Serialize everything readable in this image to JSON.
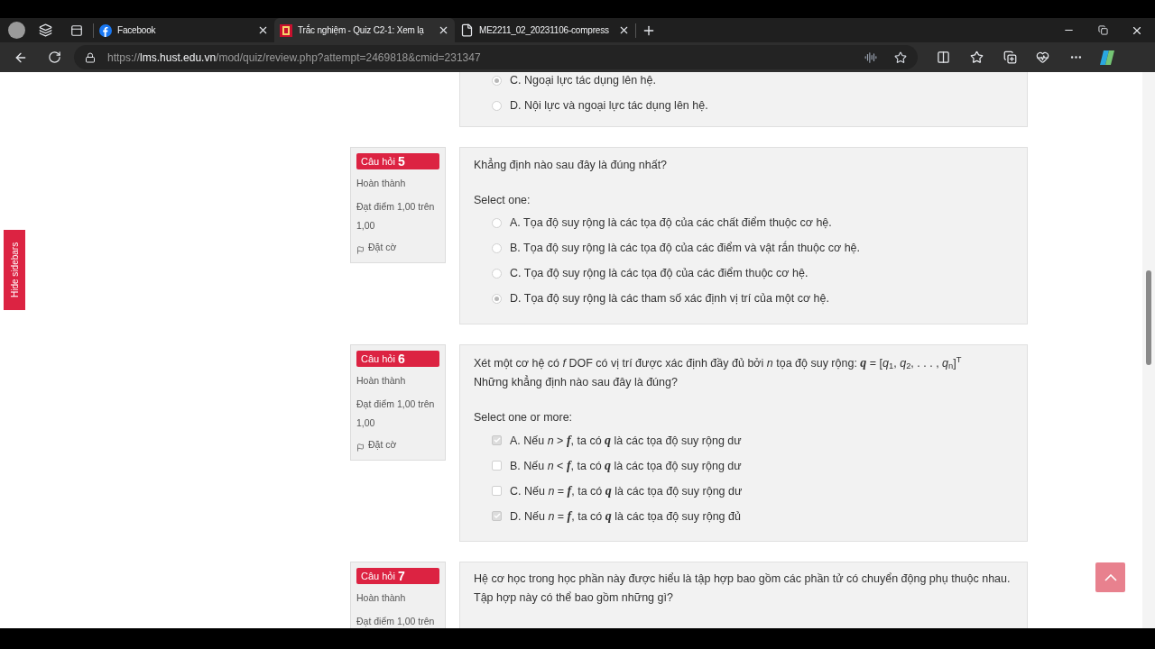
{
  "browser": {
    "tabs": [
      {
        "title": "Facebook",
        "selected": false
      },
      {
        "title": "Trắc nghiệm - Quiz C2-1: Xem lạ",
        "selected": true
      },
      {
        "title": "ME2211_02_20231106-compress",
        "selected": false
      }
    ],
    "address": {
      "scheme": "https://",
      "host": "lms.hust.edu.vn",
      "path": "/mod/quiz/review.php?attempt=2469818&cmid=231347"
    }
  },
  "sidebar_toggle": "Hide sidebars",
  "questions": [
    {
      "options": [
        {
          "kind": "radio",
          "label": "C. Ngoại lực tác dụng lên hệ.",
          "selected": true
        },
        {
          "kind": "radio",
          "label": "D. Nội lực và ngoại lực tác dụng lên hệ.",
          "selected": false
        }
      ]
    },
    {
      "info": {
        "label": "Câu hỏi",
        "number": "5",
        "status": "Hoàn thành",
        "mark": "Đạt điểm 1,00 trên 1,00",
        "flag": "Đặt cờ"
      },
      "prompt": [
        "Khẳng định nào sau đây là đúng nhất?"
      ],
      "instruction": "Select one:",
      "options": [
        {
          "kind": "radio",
          "label": "A. Tọa độ suy rộng là các tọa độ của các chất điểm thuộc cơ hệ.",
          "selected": false
        },
        {
          "kind": "radio",
          "label": "B. Tọa độ suy rộng là các tọa độ của các điểm và vật rắn thuộc cơ hệ.",
          "selected": false
        },
        {
          "kind": "radio",
          "label": "C. Tọa độ suy rộng là các tọa độ của các điểm thuộc cơ hệ.",
          "selected": false
        },
        {
          "kind": "radio",
          "label": "D. Tọa độ suy rộng là các tham số xác định vị trí của một cơ hệ.",
          "selected": true
        }
      ]
    },
    {
      "info": {
        "label": "Câu hỏi",
        "number": "6",
        "status": "Hoàn thành",
        "mark": "Đạt điểm 1,00 trên 1,00",
        "flag": "Đặt cờ"
      },
      "prompt": [
        "Xét một cơ hệ có *f* DOF có vị trí được xác định đầy đủ bởi *n* tọa độ suy rộng: **q** = [*q*$_{1}$, *q*$_{2}$, . . . , *q*$_{n}$]$^{T}$",
        "Những khẳng định nào sau đây là đúng?"
      ],
      "instruction": "Select one or more:",
      "options": [
        {
          "kind": "checkbox",
          "label": "A. Nếu *n* > **f**, ta có **q** là các tọa độ suy rộng dư",
          "checked": true
        },
        {
          "kind": "checkbox",
          "label": "B. Nếu *n* < **f**, ta có **q** là các tọa độ suy rộng dư",
          "checked": false
        },
        {
          "kind": "checkbox",
          "label": "C. Nếu *n* = **f**, ta có **q** là các tọa độ suy rộng dư",
          "checked": false
        },
        {
          "kind": "checkbox",
          "label": "D. Nếu *n* = **f**, ta có **q** là các tọa độ suy rộng đủ",
          "checked": true
        }
      ]
    },
    {
      "info": {
        "label": "Câu hỏi",
        "number": "7",
        "status": "Hoàn thành",
        "mark": "Đạt điểm 1,00 trên"
      },
      "prompt": [
        "Hệ cơ học trong học phần này được hiểu là tập hợp bao gồm các phần tử có chuyển động phụ thuộc nhau.",
        "Tập hợp này có thể bao gồm những gì?"
      ]
    }
  ]
}
